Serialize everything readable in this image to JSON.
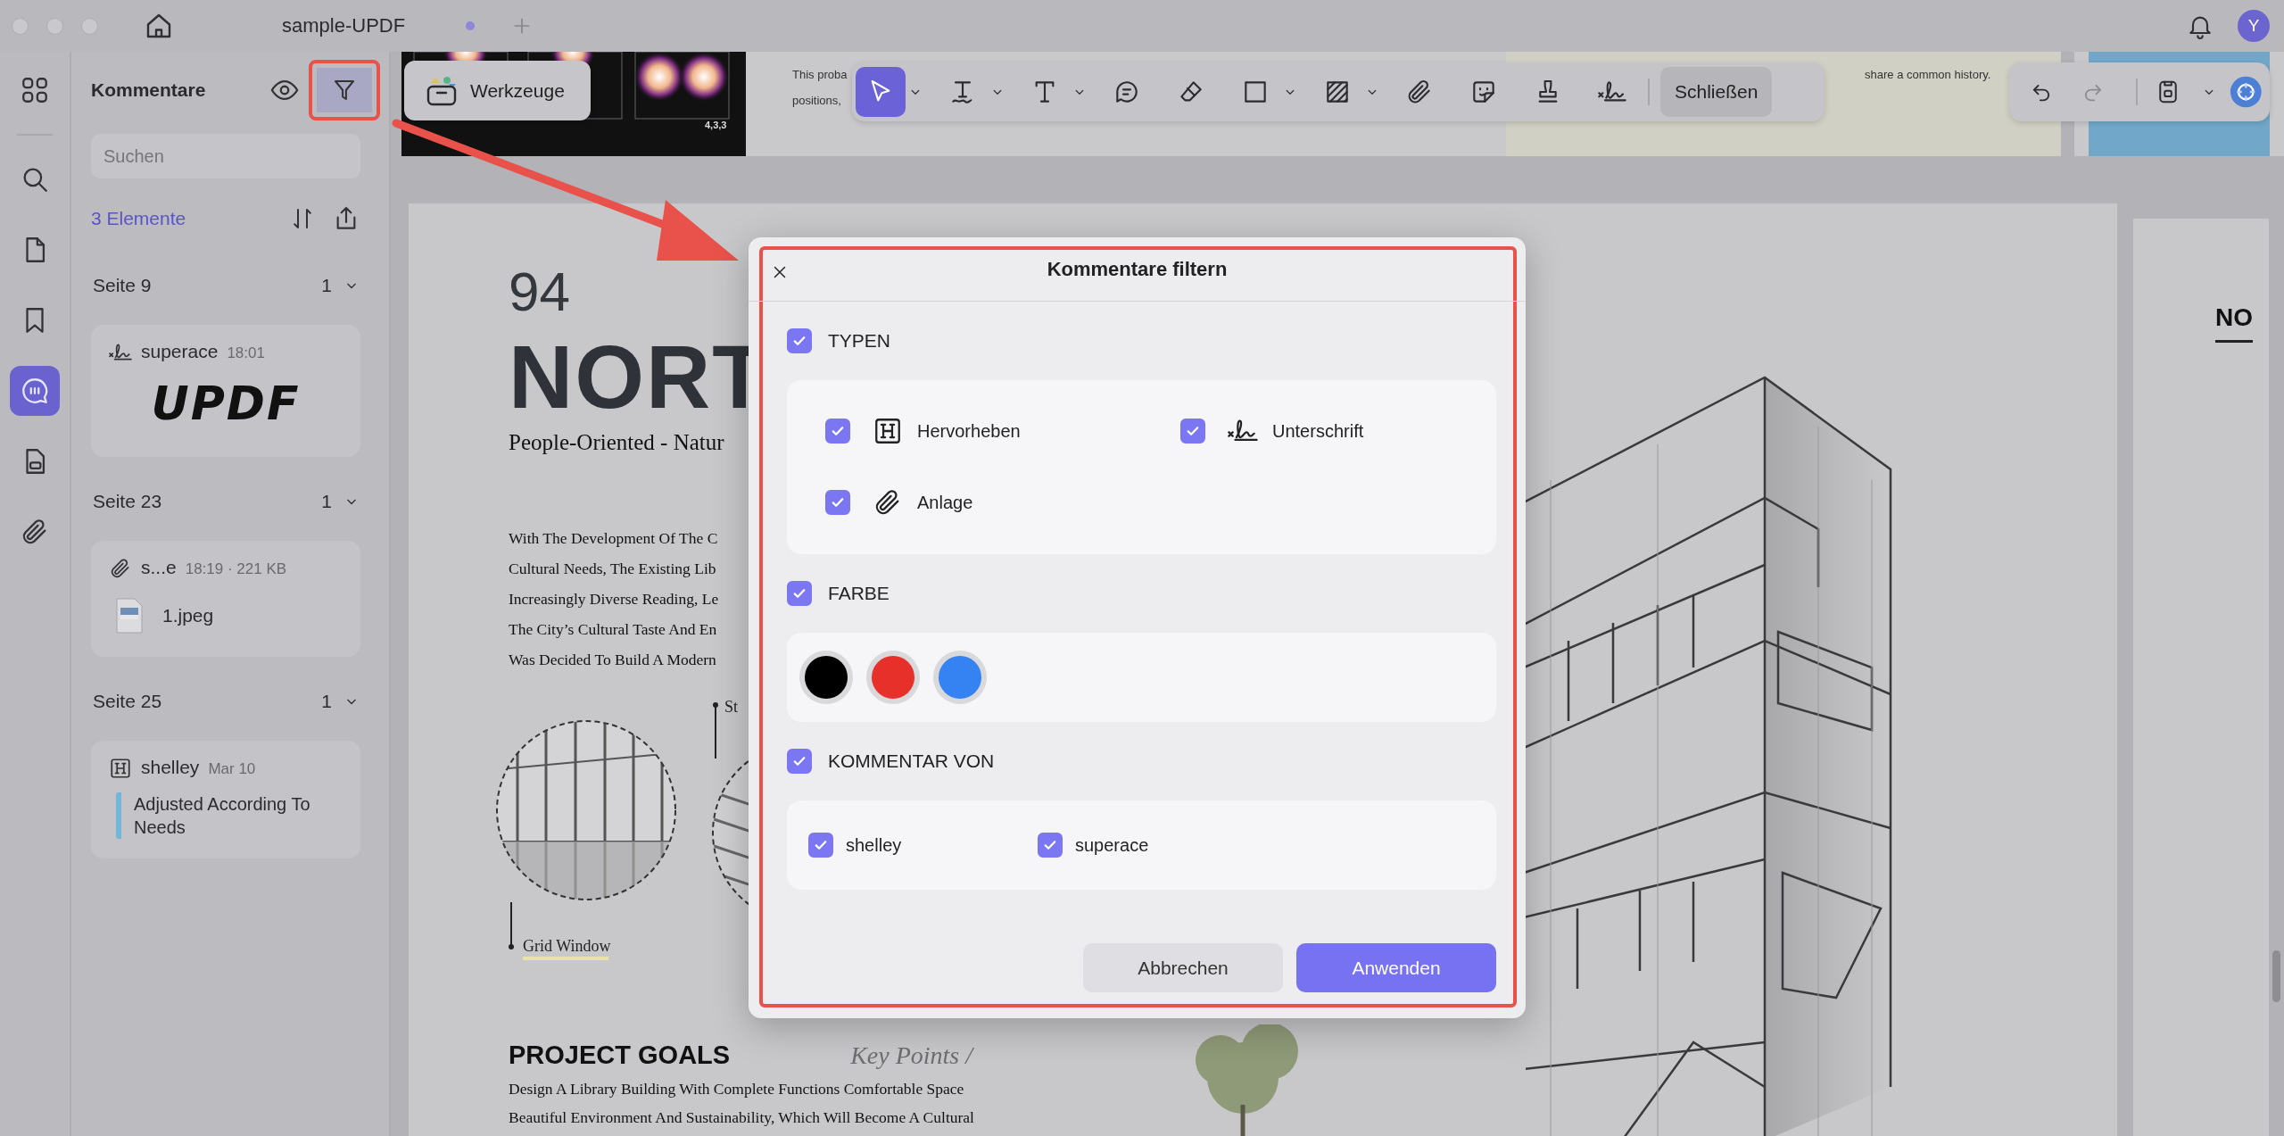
{
  "window": {
    "tab_title": "sample-UPDF",
    "tab_unsaved": true,
    "avatar": "Y"
  },
  "rail": [
    {
      "kind": "grid",
      "selected": false
    },
    {
      "kind": "search",
      "selected": false
    },
    {
      "kind": "page",
      "selected": false
    },
    {
      "kind": "bookmark",
      "selected": false
    },
    {
      "kind": "comments",
      "selected": true
    },
    {
      "kind": "form",
      "selected": false
    },
    {
      "kind": "attachment",
      "selected": false
    }
  ],
  "sidebar": {
    "title": "Kommentare",
    "filter_highlighted": true,
    "search": {
      "placeholder": "Suchen"
    },
    "count": "3 Elemente",
    "groups": [
      {
        "page": "Seite 9",
        "count": "1",
        "comment": {
          "kind": "signature",
          "author": "superace",
          "meta": "18:01",
          "signature": "UPDF"
        }
      },
      {
        "page": "Seite 23",
        "count": "1",
        "comment": {
          "kind": "attachment",
          "author": "s...e",
          "meta": "18:19 · 221 KB",
          "file": "1.jpeg"
        }
      },
      {
        "page": "Seite 25",
        "count": "1",
        "comment": {
          "kind": "highlight",
          "author": "shelley",
          "meta": "Mar 10",
          "note": "Adjusted According To Needs"
        }
      }
    ]
  },
  "tools_button": "Werkzeuge",
  "toolbar": {
    "items": [
      {
        "kind": "select",
        "selected": true,
        "menu": true
      },
      {
        "kind": "text_underline",
        "selected": false,
        "menu": true
      },
      {
        "kind": "text",
        "selected": false,
        "menu": true
      },
      {
        "kind": "comment",
        "selected": false,
        "menu": false
      },
      {
        "kind": "eraser",
        "selected": false,
        "menu": false
      },
      {
        "kind": "rectangle",
        "selected": false,
        "menu": true
      },
      {
        "kind": "area",
        "selected": false,
        "menu": true
      },
      {
        "kind": "attachment",
        "selected": false,
        "menu": false
      },
      {
        "kind": "sticker",
        "selected": false,
        "menu": false
      },
      {
        "kind": "stamp",
        "selected": false,
        "menu": false
      },
      {
        "kind": "signature",
        "selected": false,
        "menu": false
      }
    ],
    "close": "Schließen"
  },
  "history": [
    {
      "kind": "undo",
      "disabled": false
    },
    {
      "kind": "redo",
      "disabled": true
    }
  ],
  "previous_page": {
    "figure_label": "4,3,3",
    "lines": [
      "This proba",
      "positions,"
    ],
    "note": "share a common history."
  },
  "page": {
    "number": "94",
    "title": "NORT",
    "subtitle": "People-Oriented - Natur",
    "intro_lines": [
      "With The Development Of The C",
      "Cultural Needs, The Existing Lib",
      "Increasingly Diverse Reading, Le",
      "The City’s Cultural Taste And En",
      "Was Decided To Build A Modern"
    ],
    "callouts": [
      "St",
      "Grid Window"
    ],
    "section_title": "PROJECT GOALS",
    "key_points": "Key Points /",
    "goal_lines": [
      "Design A Library Building With Complete Functions Comfortable Space",
      "Beautiful Environment And Sustainability, Which Will Become A Cultural"
    ]
  },
  "next_page": {
    "heading": "NO"
  },
  "annotation_arrow": true,
  "dialog": {
    "title": "Kommentare filtern",
    "highlighted": true,
    "sections": [
      {
        "kind": "types",
        "label": "TYPEN",
        "checked": true,
        "options": [
          {
            "kind": "highlight",
            "label": "Hervorheben",
            "checked": true
          },
          {
            "kind": "signature",
            "label": "Unterschrift",
            "checked": true
          },
          {
            "kind": "attachment",
            "label": "Anlage",
            "checked": true
          }
        ]
      },
      {
        "kind": "colors",
        "label": "FARBE",
        "checked": true,
        "colors": [
          {
            "color": "#000000"
          },
          {
            "color": "#e8302a"
          },
          {
            "color": "#3582f2"
          }
        ]
      },
      {
        "kind": "authors",
        "label": "KOMMENTAR VON",
        "checked": true,
        "options": [
          {
            "label": "shelley",
            "checked": true
          },
          {
            "label": "superace",
            "checked": true
          }
        ]
      }
    ],
    "buttons": [
      {
        "kind": "secondary",
        "label": "Abbrechen"
      },
      {
        "kind": "primary",
        "label": "Anwenden"
      }
    ]
  }
}
